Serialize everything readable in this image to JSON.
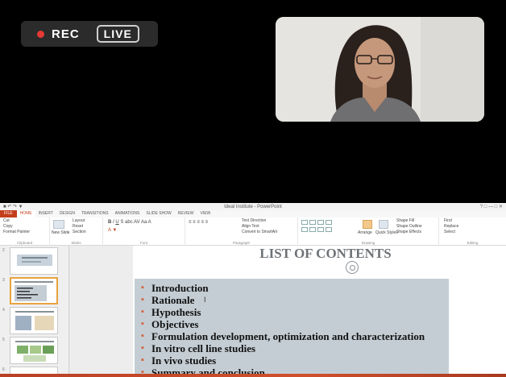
{
  "call": {
    "rec_label": "REC",
    "live_label": "LIVE",
    "rec_color": "#e53935"
  },
  "ppt": {
    "window_title": "Ideal Institute - PowerPoint",
    "tabs": {
      "file": "FILE",
      "home": "HOME",
      "insert": "INSERT",
      "design": "DESIGN",
      "transitions": "TRANSITIONS",
      "animations": "ANIMATIONS",
      "slideshow": "SLIDE SHOW",
      "review": "REVIEW",
      "view": "VIEW"
    },
    "ribbon": {
      "cut": "Cut",
      "copy": "Copy",
      "format_painter": "Format Painter",
      "clipboard": "Clipboard",
      "new_slide": "New Slide",
      "layout": "Layout",
      "reset": "Reset",
      "section": "Section",
      "slides": "Slides",
      "font": "Font",
      "text_direction": "Text Direction",
      "align_text": "Align Text",
      "convert_smartart": "Convert to SmartArt",
      "paragraph": "Paragraph",
      "arrange": "Arrange",
      "quick_styles": "Quick Styles",
      "shape_fill": "Shape Fill",
      "shape_outline": "Shape Outline",
      "shape_effects": "Shape Effects",
      "drawing": "Drawing",
      "find": "Find",
      "replace": "Replace",
      "select": "Select",
      "editing": "Editing"
    },
    "slide_numbers": [
      "2",
      "3",
      "4",
      "5",
      "6"
    ],
    "slide": {
      "title": "LIST OF CONTENTS",
      "bullets": [
        "Introduction",
        "Rationale",
        "Hypothesis",
        "Objectives",
        "Formulation development, optimization and characterization",
        "In vitro cell line studies",
        "In vivo studies",
        "Summary and conclusion"
      ],
      "bullet_color": "#d5613a",
      "box_color": "#c4cdd4"
    },
    "accent_color": "#c43e1c"
  }
}
